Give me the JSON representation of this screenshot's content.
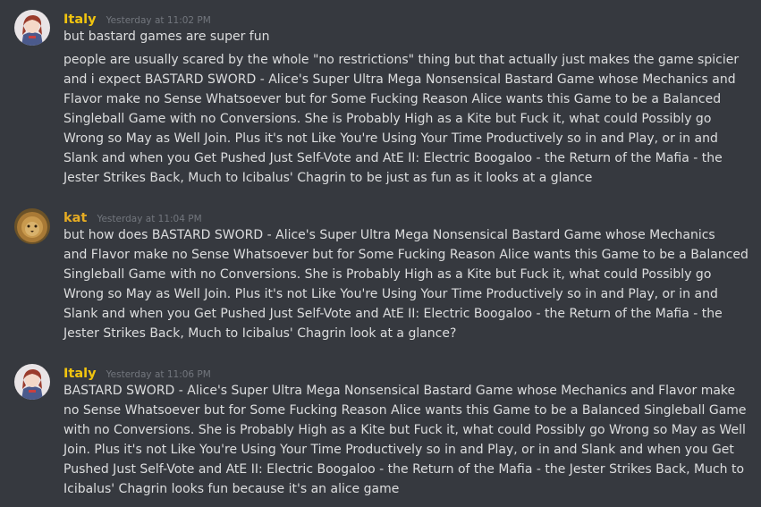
{
  "colors": {
    "background": "#36393f",
    "text": "#dcddde",
    "timestamp": "#72767d",
    "username_yellow": "#f1c40f",
    "username_kat": "#e6ac23"
  },
  "messages": [
    {
      "username": "Italy",
      "timestamp": "Yesterday at 11:02 PM",
      "avatar": "anime-character-avatar",
      "paragraphs": [
        [
          "but bastard games are super fun"
        ],
        [
          "people are usually scared by the whole \"no restrictions\" thing but that actually just makes the game spicier",
          "and i expect BASTARD SWORD - Alice's Super Ultra Mega Nonsensical Bastard Game whose Mechanics and",
          "Flavor make no Sense Whatsoever but for Some Fucking Reason Alice wants this Game to be a Balanced",
          "Singleball Game with no Conversions. She is Probably High as a Kite but Fuck it, what could Possibly go",
          "Wrong so May as Well Join. Plus it's not Like You're Using Your Time Productively so in and Play, or in and",
          "Slank and when you Get Pushed Just Self-Vote and AtE II: Electric Boogaloo - the Return of the Mafia - the",
          "Jester Strikes Back, Much to Icibalus' Chagrin to be just as fun as it looks at a glance"
        ]
      ]
    },
    {
      "username": "kat",
      "timestamp": "Yesterday at 11:04 PM",
      "avatar": "lion-avatar",
      "paragraphs": [
        [
          "but how does BASTARD SWORD - Alice's Super Ultra Mega Nonsensical Bastard Game whose Mechanics",
          "and Flavor make no Sense Whatsoever but for Some Fucking Reason Alice wants this Game to be a Balanced",
          "Singleball Game with no Conversions. She is Probably High as a Kite but Fuck it, what could Possibly go",
          "Wrong so May as Well Join. Plus it's not Like You're Using Your Time Productively so in and Play, or in and",
          "Slank and when you Get Pushed Just Self-Vote and AtE II: Electric Boogaloo - the Return of the Mafia - the",
          "Jester Strikes Back, Much to Icibalus' Chagrin look at a glance?"
        ]
      ]
    },
    {
      "username": "Italy",
      "timestamp": "Yesterday at 11:06 PM",
      "avatar": "anime-character-avatar",
      "paragraphs": [
        [
          "BASTARD SWORD - Alice's Super Ultra Mega Nonsensical Bastard Game whose Mechanics and Flavor make",
          "no Sense Whatsoever but for Some Fucking Reason Alice wants this Game to be a Balanced Singleball Game",
          "with no Conversions. She is Probably High as a Kite but Fuck it, what could Possibly go Wrong so May as Well",
          "Join. Plus it's not Like You're Using Your Time Productively so in and Play, or in and Slank and when you Get",
          "Pushed Just Self-Vote and AtE II: Electric Boogaloo - the Return of the Mafia - the Jester Strikes Back, Much to",
          "Icibalus' Chagrin looks fun because it's an alice game"
        ]
      ]
    }
  ]
}
